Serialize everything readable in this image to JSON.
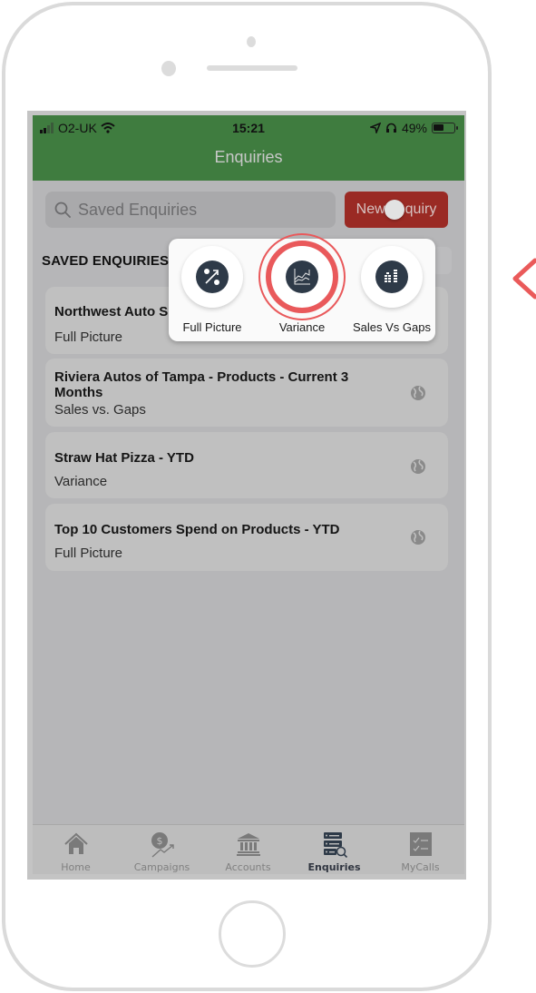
{
  "status_bar": {
    "carrier": "O2-UK",
    "time": "15:21",
    "battery": "49%"
  },
  "header": {
    "title": "Enquiries"
  },
  "search": {
    "placeholder": "Saved Enquiries"
  },
  "new_enquiry_button": {
    "label": "New Enquiry",
    "visible_label_left": "New",
    "visible_label_right": "quiry"
  },
  "section_title": "SAVED ENQUIRIES",
  "saved_enquiries": [
    {
      "title": "Northwest Auto S",
      "type": "Full Picture",
      "shared": false
    },
    {
      "title": "Riviera Autos of Tampa - Products - Current 3 Months",
      "type": "Sales vs. Gaps",
      "shared": true
    },
    {
      "title": "Straw Hat Pizza - YTD",
      "type": "Variance",
      "shared": true
    },
    {
      "title": "Top 10 Customers Spend on Products - YTD",
      "type": "Full Picture",
      "shared": true
    }
  ],
  "enquiry_type_popup": {
    "options": [
      {
        "label": "Full Picture",
        "icon": "full-picture-icon",
        "highlighted": false
      },
      {
        "label": "Variance",
        "icon": "variance-chart-icon",
        "highlighted": true
      },
      {
        "label": "Sales Vs Gaps",
        "icon": "sales-vs-gaps-icon",
        "highlighted": false
      }
    ]
  },
  "tab_bar": {
    "active": "Enquiries",
    "tabs": [
      {
        "label": "Home",
        "icon": "home-icon"
      },
      {
        "label": "Campaigns",
        "icon": "campaigns-icon"
      },
      {
        "label": "Accounts",
        "icon": "bank-icon"
      },
      {
        "label": "Enquiries",
        "icon": "enquiries-icon"
      },
      {
        "label": "MyCalls",
        "icon": "checklist-icon"
      }
    ]
  },
  "colors": {
    "header_green": "#3f7c3f",
    "new_button_red": "#9a2a24",
    "highlight_ring": "#e9595b",
    "icon_navy": "#2e3a48",
    "overlay_bg": "#b6b6b8"
  }
}
